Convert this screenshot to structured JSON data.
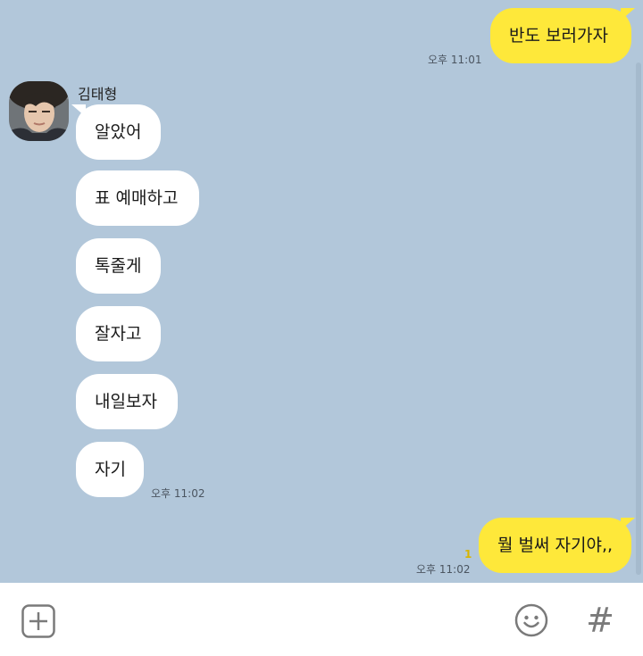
{
  "conversation": {
    "partner_name": "김태형",
    "messages": [
      {
        "text": "반도 보러가자",
        "time": "오후 11:01"
      },
      {
        "text": "알았어"
      },
      {
        "text": "표 예매하고"
      },
      {
        "text": "톡줄게"
      },
      {
        "text": "잘자고"
      },
      {
        "text": "내일보자"
      },
      {
        "text": "자기",
        "time": "오후 11:02"
      },
      {
        "text": "뭘 벌써 자기야,,",
        "time": "오후 11:02",
        "unread": "1"
      }
    ]
  },
  "input_bar": {
    "add_icon": "plus-square-icon",
    "emoji_icon": "smiley-icon",
    "hash_icon": "hash-icon",
    "hash_label": "#"
  },
  "colors": {
    "chat_background": "#b2c7da",
    "my_bubble": "#fee83a",
    "partner_bubble": "#ffffff",
    "unread_count": "#d7b400"
  }
}
